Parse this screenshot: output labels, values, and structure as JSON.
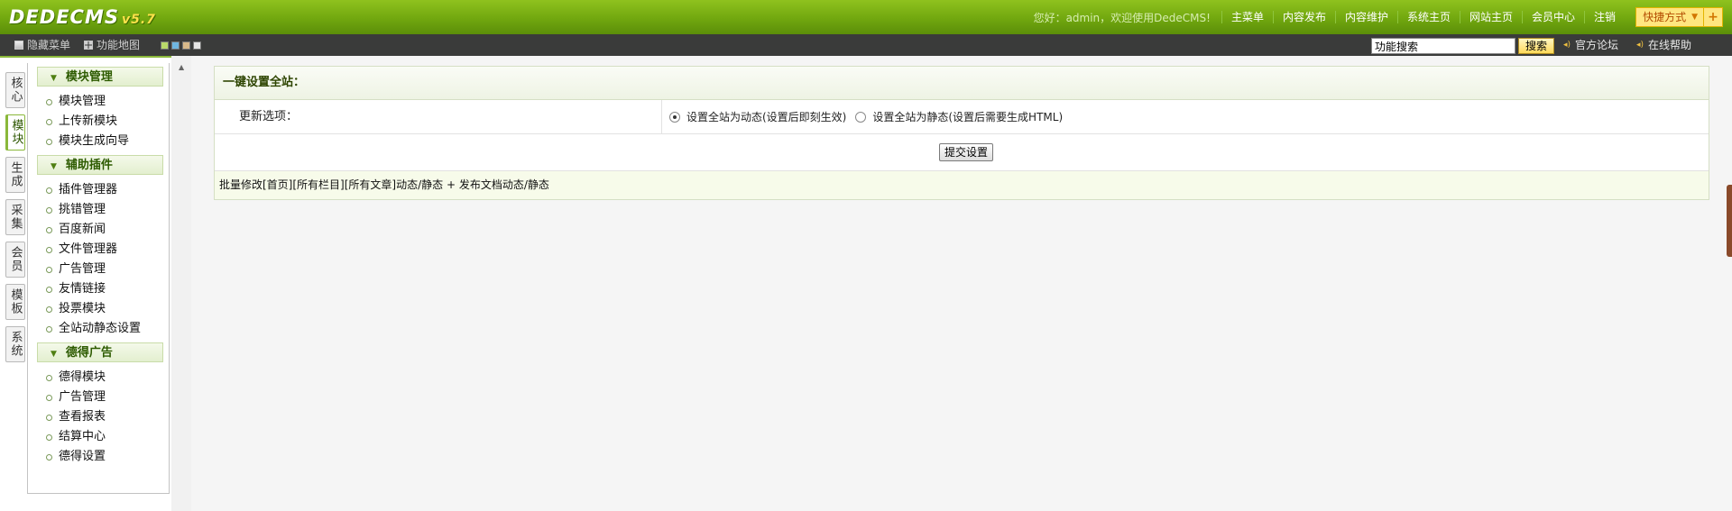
{
  "header": {
    "logo_text": "DEDECMS",
    "version": "v5.7",
    "welcome": "您好：admin，欢迎使用DedeCMS!",
    "links": [
      "主菜单",
      "内容发布",
      "内容维护",
      "系统主页",
      "网站主页",
      "会员中心",
      "注销"
    ],
    "quick_label": "快捷方式",
    "quick_add": "+"
  },
  "toolbar": {
    "hide_menu": "隐藏菜单",
    "function_map": "功能地图",
    "skin_colors": [
      "#b9d96a",
      "#6fb6e0",
      "#d8b98a",
      "#e5e5e5"
    ],
    "search_value": "功能搜索",
    "search_button": "搜索",
    "forum_link": "官方论坛",
    "help_link": "在线帮助"
  },
  "vtabs": [
    {
      "label": "核心",
      "active": false
    },
    {
      "label": "模块",
      "active": true
    },
    {
      "label": "生成",
      "active": false
    },
    {
      "label": "采集",
      "active": false
    },
    {
      "label": "会员",
      "active": false
    },
    {
      "label": "模板",
      "active": false
    },
    {
      "label": "系统",
      "active": false
    }
  ],
  "sidebar": {
    "groups": [
      {
        "title": "模块管理",
        "items": [
          "模块管理",
          "上传新模块",
          "模块生成向导"
        ]
      },
      {
        "title": "辅助插件",
        "items": [
          "插件管理器",
          "挑错管理",
          "百度新闻",
          "文件管理器",
          "广告管理",
          "友情链接",
          "投票模块",
          "全站动静态设置"
        ]
      },
      {
        "title": "德得广告",
        "items": [
          "德得模块",
          "广告管理",
          "查看报表",
          "结算中心",
          "德得设置"
        ]
      }
    ]
  },
  "main": {
    "panel_title": "一键设置全站：",
    "option_label": "更新选项：",
    "radio_dynamic": "设置全站为动态(设置后即刻生效)",
    "radio_static": "设置全站为静态(设置后需要生成HTML)",
    "selected": "dynamic",
    "submit_label": "提交设置",
    "footer_text": "批量修改[首页][所有栏目][所有文章]动态/静态 + 发布文档动态/静态"
  }
}
